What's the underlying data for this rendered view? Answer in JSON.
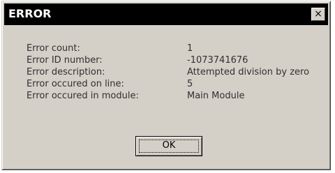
{
  "window": {
    "title": "ERROR",
    "close_label": "×"
  },
  "details": [
    {
      "label": "Error count:",
      "value": "1"
    },
    {
      "label": "Error ID number:",
      "value": "-1073741676"
    },
    {
      "label": "Error description:",
      "value": "Attempted division by zero"
    },
    {
      "label": "Error occured on line:",
      "value": "5"
    },
    {
      "label": "Error occured in module:",
      "value": "Main Module"
    }
  ],
  "buttons": {
    "ok_label": "OK"
  },
  "colors": {
    "dialog_face": "#d4d0c8",
    "titlebar": "#000000",
    "title_text": "#ffffff",
    "body_text": "#303030"
  }
}
